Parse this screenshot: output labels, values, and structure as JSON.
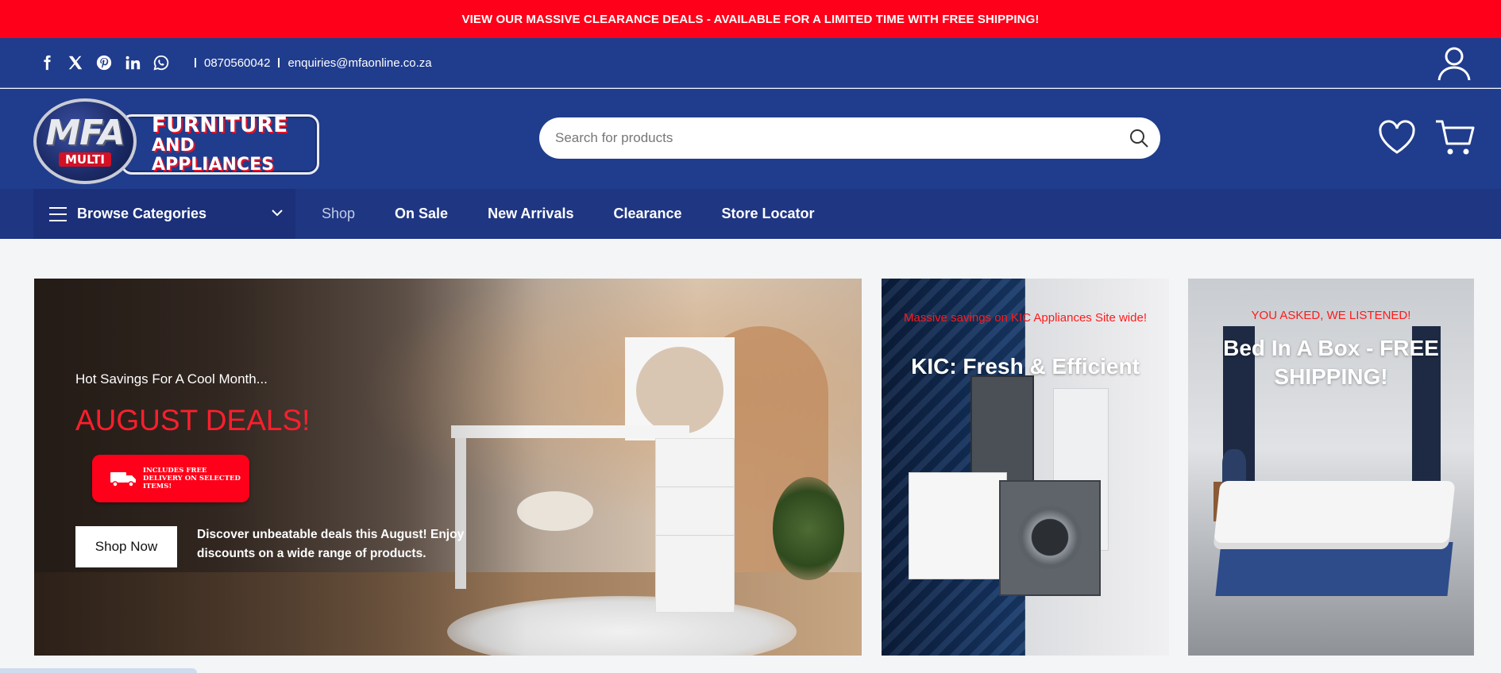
{
  "announcement": {
    "text": "VIEW OUR MASSIVE CLEARANCE DEALS - AVAILABLE FOR A LIMITED TIME WITH FREE SHIPPING!"
  },
  "topbar": {
    "social": [
      "facebook-icon",
      "x-icon",
      "pinterest-icon",
      "linkedin-icon",
      "whatsapp-icon"
    ],
    "phone": "0870560042",
    "email": "enquiries@mfaonline.co.za"
  },
  "logo": {
    "mark": "MFA",
    "sub": "MULTI",
    "line1": "FURNITURE",
    "line2": "AND APPLIANCES"
  },
  "search": {
    "placeholder": "Search for products"
  },
  "nav": {
    "browse_label": "Browse Categories",
    "links": [
      "Shop",
      "On Sale",
      "New Arrivals",
      "Clearance",
      "Store Locator"
    ]
  },
  "hero": {
    "kicker": "Hot Savings For A Cool Month...",
    "headline": "AUGUST DEALS!",
    "badge": "INCLUDES FREE DELIVERY ON SELECTED ITEMS!",
    "button": "Shop Now",
    "description": "Discover unbeatable deals this August! Enjoy discounts on a wide range of products."
  },
  "promo_kic": {
    "kicker": "Massive savings on KIC Appliances Site wide!",
    "title": "KIC: Fresh & Efficient"
  },
  "promo_bed": {
    "kicker": "YOU ASKED, WE LISTENED!",
    "title": "Bed In A Box - FREE SHIPPING!"
  },
  "colors": {
    "accent_red": "#fe0019",
    "brand_blue": "#203c8c",
    "nav_blue": "#1f3683"
  }
}
